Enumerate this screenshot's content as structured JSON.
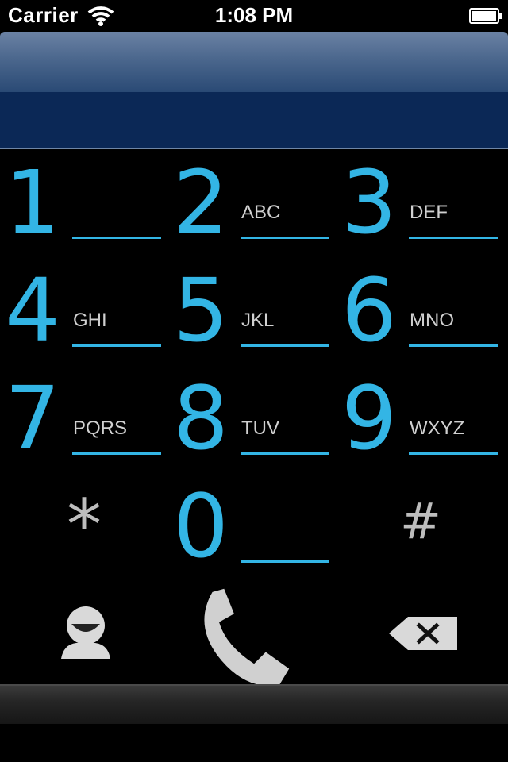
{
  "status_bar": {
    "carrier": "Carrier",
    "time": "1:08 PM"
  },
  "display": {
    "number": ""
  },
  "keypad": {
    "keys": [
      {
        "digit": "1",
        "letters": ""
      },
      {
        "digit": "2",
        "letters": "ABC"
      },
      {
        "digit": "3",
        "letters": "DEF"
      },
      {
        "digit": "4",
        "letters": "GHI"
      },
      {
        "digit": "5",
        "letters": "JKL"
      },
      {
        "digit": "6",
        "letters": "MNO"
      },
      {
        "digit": "7",
        "letters": "PQRS"
      },
      {
        "digit": "8",
        "letters": "TUV"
      },
      {
        "digit": "9",
        "letters": "WXYZ"
      },
      {
        "symbol": "*"
      },
      {
        "digit": "0",
        "letters": ""
      },
      {
        "symbol": "#"
      }
    ]
  },
  "actions": {
    "contacts_icon": "contacts-icon",
    "call_icon": "phone-handset-icon",
    "delete_icon": "backspace-icon"
  },
  "colors": {
    "digit": "#33b5e5",
    "letters": "#d0d0d0",
    "header_dark": "#0b2856",
    "background": "#000000"
  }
}
